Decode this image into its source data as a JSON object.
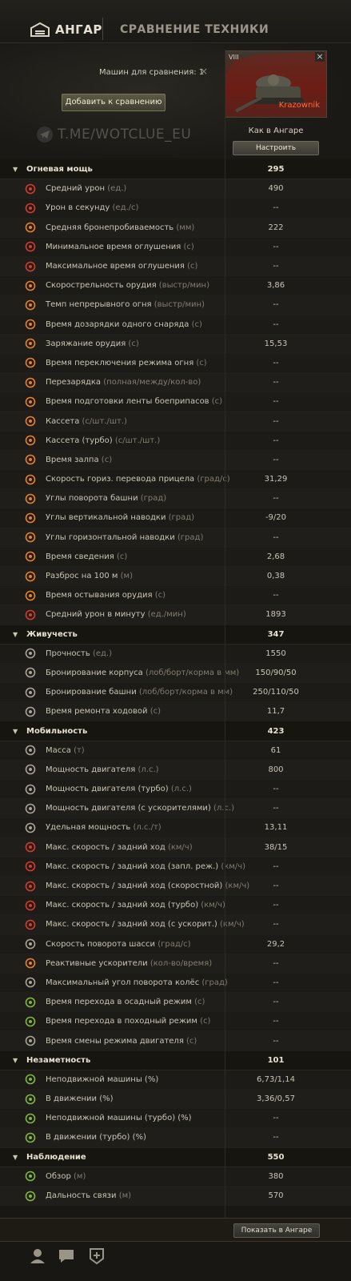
{
  "nav": {
    "hangar": "АНГАР",
    "compare": "СРАВНЕНИЕ ТЕХНИКИ"
  },
  "header": {
    "machines_count": "Машин для сравнения: 1",
    "clear": "×",
    "add_button": "Добавить к сравнению",
    "watermark": "T.ME/WOTCLUE_EU"
  },
  "tank": {
    "tier": "VIII",
    "name": "Krazownik",
    "close": "×",
    "config_label": "Как в Ангаре",
    "config_button": "Настроить"
  },
  "sections": [
    {
      "name": "Огневая мощь",
      "value": "295",
      "rows": [
        {
          "label": "Средний урон",
          "unit": "(ед.)",
          "value": "490",
          "icon": "damage-icon"
        },
        {
          "label": "Урон в секунду",
          "unit": "(ед./с)",
          "value": "--",
          "icon": "dps-icon"
        },
        {
          "label": "Средняя бронепробиваемость",
          "unit": "(мм)",
          "value": "222",
          "icon": "penetration-icon"
        },
        {
          "label": "Минимальное время оглушения",
          "unit": "(с)",
          "value": "--",
          "icon": "stun-icon"
        },
        {
          "label": "Максимальное время оглушения",
          "unit": "(с)",
          "value": "--",
          "icon": "stun-icon"
        },
        {
          "label": "Скорострельность орудия",
          "unit": "(выстр/мин)",
          "value": "3,86",
          "icon": "rate-of-fire-icon"
        },
        {
          "label": "Темп непрерывного огня",
          "unit": "(выстр/мин)",
          "value": "--",
          "icon": "continuous-fire-icon"
        },
        {
          "label": "Время дозарядки одного снаряда",
          "unit": "(с)",
          "value": "--",
          "icon": "shell-reload-icon"
        },
        {
          "label": "Заряжание орудия",
          "unit": "(с)",
          "value": "15,53",
          "icon": "reload-icon"
        },
        {
          "label": "Время переключения режима огня",
          "unit": "(с)",
          "value": "--",
          "icon": "fire-mode-icon"
        },
        {
          "label": "Перезарядка",
          "unit": "(полная/между/кол-во)",
          "value": "--",
          "icon": "autoreload-icon"
        },
        {
          "label": "Время подготовки ленты боеприпасов",
          "unit": "(с)",
          "value": "--",
          "icon": "ammo-belt-icon"
        },
        {
          "label": "Кассета",
          "unit": "(с/шт./шт.)",
          "value": "--",
          "icon": "magazine-icon"
        },
        {
          "label": "Кассета (турбо)",
          "unit": "(с/шт./шт.)",
          "value": "--",
          "icon": "magazine-turbo-icon"
        },
        {
          "label": "Время залпа",
          "unit": "(с)",
          "value": "--",
          "icon": "salvo-icon"
        },
        {
          "label": "Скорость гориз. перевода прицела",
          "unit": "(град/с)",
          "value": "31,29",
          "icon": "traverse-icon"
        },
        {
          "label": "Углы поворота башни",
          "unit": "(град)",
          "value": "--",
          "icon": "turret-angles-icon"
        },
        {
          "label": "Углы вертикальной наводки",
          "unit": "(град)",
          "value": "-9/20",
          "icon": "elevation-icon"
        },
        {
          "label": "Углы горизонтальной наводки",
          "unit": "(град)",
          "value": "--",
          "icon": "horizontal-angles-icon"
        },
        {
          "label": "Время сведения",
          "unit": "(с)",
          "value": "2,68",
          "icon": "aim-time-icon"
        },
        {
          "label": "Разброс на 100 м",
          "unit": "(м)",
          "value": "0,38",
          "icon": "dispersion-icon"
        },
        {
          "label": "Время остывания орудия",
          "unit": "(с)",
          "value": "--",
          "icon": "cooldown-icon"
        },
        {
          "label": "Средний урон в минуту",
          "unit": "(ед./мин)",
          "value": "1893",
          "icon": "damage-per-minute-icon"
        }
      ]
    },
    {
      "name": "Живучесть",
      "value": "347",
      "rows": [
        {
          "label": "Прочность",
          "unit": "(ед.)",
          "value": "1550",
          "icon": "hitpoints-icon"
        },
        {
          "label": "Бронирование корпуса",
          "unit": "(лоб/борт/корма в мм)",
          "value": "150/90/50",
          "icon": "hull-armor-icon"
        },
        {
          "label": "Бронирование башни",
          "unit": "(лоб/борт/корма в мм)",
          "value": "250/110/50",
          "icon": "turret-armor-icon"
        },
        {
          "label": "Время ремонта ходовой",
          "unit": "(с)",
          "value": "11,7",
          "icon": "repair-icon"
        }
      ]
    },
    {
      "name": "Мобильность",
      "value": "423",
      "rows": [
        {
          "label": "Масса",
          "unit": "(т)",
          "value": "61",
          "icon": "weight-icon"
        },
        {
          "label": "Мощность двигателя",
          "unit": "(л.с.)",
          "value": "800",
          "icon": "engine-icon"
        },
        {
          "label": "Мощность двигателя (турбо)",
          "unit": "(л.с.)",
          "value": "--",
          "icon": "engine-turbo-icon"
        },
        {
          "label": "Мощность двигателя (с ускорителями)",
          "unit": "(л.с.)",
          "value": "--",
          "icon": "engine-boost-icon"
        },
        {
          "label": "Удельная мощность",
          "unit": "(л.с./т)",
          "value": "13,11",
          "icon": "power-ratio-icon"
        },
        {
          "label": "Макс. скорость / задний ход",
          "unit": "(км/ч)",
          "value": "38/15",
          "icon": "speed-icon"
        },
        {
          "label": "Макс. скорость / задний ход (запл. реж.)",
          "unit": "(км/ч)",
          "value": "--",
          "icon": "speed-icon"
        },
        {
          "label": "Макс. скорость / задний ход (скоростной)",
          "unit": "(км/ч)",
          "value": "--",
          "icon": "speed-icon"
        },
        {
          "label": "Макс. скорость / задний ход (турбо)",
          "unit": "(км/ч)",
          "value": "--",
          "icon": "speed-icon"
        },
        {
          "label": "Макс. скорость / задний ход (с ускорит.)",
          "unit": "(км/ч)",
          "value": "--",
          "icon": "speed-icon"
        },
        {
          "label": "Скорость поворота шасси",
          "unit": "(град/с)",
          "value": "29,2",
          "icon": "hull-traverse-icon"
        },
        {
          "label": "Реактивные ускорители",
          "unit": "(кол-во/время)",
          "value": "--",
          "icon": "rocket-boost-icon"
        },
        {
          "label": "Максимальный угол поворота колёс",
          "unit": "(град)",
          "value": "--",
          "icon": "wheel-angle-icon"
        },
        {
          "label": "Время перехода в осадный режим",
          "unit": "(с)",
          "value": "--",
          "icon": "siege-mode-icon"
        },
        {
          "label": "Время перехода в походный режим",
          "unit": "(с)",
          "value": "--",
          "icon": "travel-mode-icon"
        },
        {
          "label": "Время смены режима двигателя",
          "unit": "(с)",
          "value": "--",
          "icon": "engine-mode-icon"
        }
      ]
    },
    {
      "name": "Незаметность",
      "value": "101",
      "rows": [
        {
          "label": "Неподвижной машины (%)",
          "unit": "",
          "value": "6,73/1,14",
          "icon": "camo-stationary-icon"
        },
        {
          "label": "В движении (%)",
          "unit": "",
          "value": "3,36/0,57",
          "icon": "camo-moving-icon"
        },
        {
          "label": "Неподвижной машины (турбо) (%)",
          "unit": "",
          "value": "--",
          "icon": "camo-stationary-icon"
        },
        {
          "label": "В движении (турбо) (%)",
          "unit": "",
          "value": "--",
          "icon": "camo-moving-icon"
        }
      ]
    },
    {
      "name": "Наблюдение",
      "value": "550",
      "rows": [
        {
          "label": "Обзор",
          "unit": "(м)",
          "value": "380",
          "icon": "view-range-icon"
        },
        {
          "label": "Дальность связи",
          "unit": "(м)",
          "value": "570",
          "icon": "radio-range-icon"
        }
      ]
    }
  ],
  "footer": {
    "show_button": "Показать в Ангаре"
  },
  "colors": {
    "accent_red": "#ff6a3d",
    "icon_orange": "#e8802a",
    "icon_red": "#d63b2a",
    "icon_green": "#7fb83a",
    "icon_gray": "#a9a49a"
  }
}
